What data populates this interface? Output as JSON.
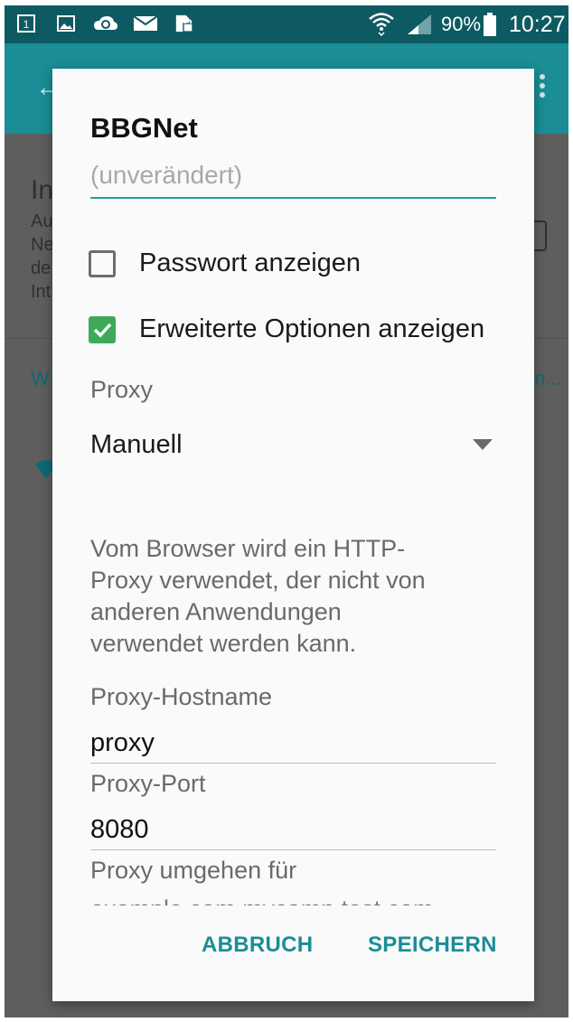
{
  "status_bar": {
    "battery": "90%",
    "time": "10:27",
    "icons": [
      "sim-1-icon",
      "image-icon",
      "cloud-sync-icon",
      "mail-icon",
      "sd-card-icon",
      "wifi-icon",
      "signal-icon",
      "battery-icon"
    ]
  },
  "background": {
    "fragments": [
      "In",
      "Au",
      "Ne",
      "de",
      "Int",
      "W",
      "n..."
    ]
  },
  "dialog": {
    "title": "BBGNet",
    "password_placeholder": "(unverändert)",
    "show_password_label": "Passwort anzeigen",
    "show_password_checked": false,
    "advanced_options_label": "Erweiterte Optionen anzeigen",
    "advanced_options_checked": true,
    "proxy_label": "Proxy",
    "proxy_value": "Manuell",
    "info_text": "Vom Browser wird ein HTTP-Proxy verwendet, der nicht von anderen Anwendungen verwendet werden kann.",
    "proxy_hostname_label": "Proxy-Hostname",
    "proxy_hostname_value": "proxy",
    "proxy_port_label": "Proxy-Port",
    "proxy_port_value": "8080",
    "bypass_label": "Proxy umgehen für",
    "bypass_placeholder": "example.com,mycomp.test.com",
    "cancel_label": "ABBRUCH",
    "save_label": "SPEICHERN"
  },
  "colors": {
    "accent": "#1a8d96",
    "checkbox_checked": "#3ea95a",
    "status_bar": "#0e5a62"
  }
}
